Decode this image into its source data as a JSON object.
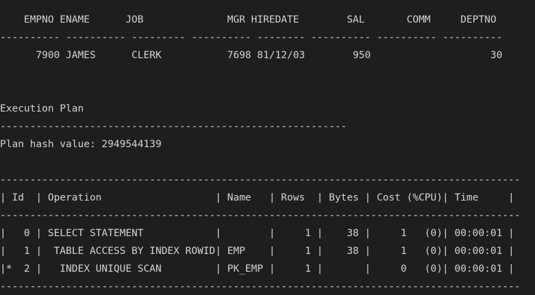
{
  "terminal": {
    "lines": [
      "    EMPNO ENAME      JOB              MGR HIREDATE        SAL       COMM     DEPTNO",
      "---------- ---------- --------- ---------- -------- ---------- ---------- ----------",
      "      7900 JAMES      CLERK           7698 81/12/03        950                    30",
      "",
      "",
      "Execution Plan",
      "----------------------------------------------------------",
      "Plan hash value: 2949544139",
      "",
      "---------------------------------------------------------------------------------------",
      "| Id  | Operation                   | Name   | Rows  | Bytes | Cost (%CPU)| Time     |",
      "---------------------------------------------------------------------------------------",
      "|   0 | SELECT STATEMENT            |        |     1 |    38 |     1   (0)| 00:00:01 |",
      "|   1 |  TABLE ACCESS BY INDEX ROWID| EMP    |     1 |    38 |     1   (0)| 00:00:01 |",
      "|*  2 |   INDEX UNIQUE SCAN         | PK_EMP |     1 |       |     0   (0)| 00:00:01 |",
      "---------------------------------------------------------------------------------------"
    ]
  }
}
